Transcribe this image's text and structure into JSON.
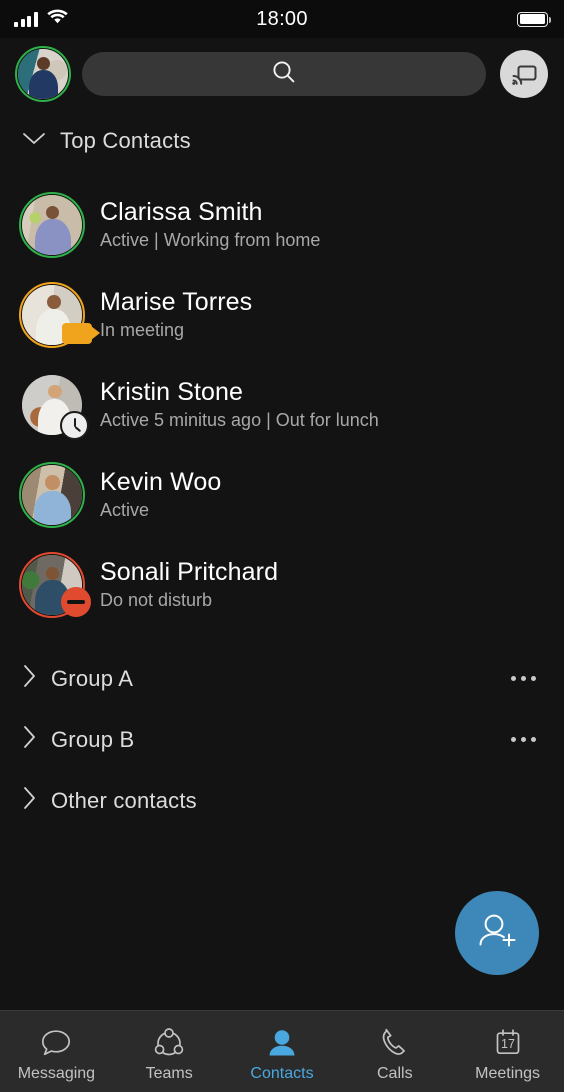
{
  "status_bar": {
    "signal_icon": "cellular-signal-icon",
    "signal_bars": 4,
    "wifi_icon": "wifi-icon",
    "time": "18:00",
    "battery_icon": "battery-full-icon",
    "battery_level_pct": 100
  },
  "header": {
    "profile_avatar": {
      "name": "my-profile-avatar",
      "presence": "available",
      "ring_color": "#2fb14a"
    },
    "search": {
      "icon": "search-icon",
      "value": "",
      "placeholder": ""
    },
    "cast_button": {
      "icon": "cast-screen-icon",
      "label": "Cast"
    }
  },
  "section": {
    "chevron_icon": "chevron-down-icon",
    "title": "Top Contacts",
    "expanded": true
  },
  "contacts": [
    {
      "name": "Clarissa Smith",
      "status": "Active | Working from home",
      "presence": "available",
      "ring_color": "#2fb14a",
      "badge": "none",
      "avatar_name": "avatar-clarissa-smith"
    },
    {
      "name": "Marise Torres",
      "status": "In meeting",
      "presence": "in-a-meeting",
      "ring_color": "#f0a41e",
      "badge": "video-camera-icon",
      "avatar_name": "avatar-marise-torres"
    },
    {
      "name": "Kristin Stone",
      "status": "Active 5 minitus ago | Out for lunch",
      "presence": "away",
      "ring_color": "none",
      "badge": "clock-icon",
      "avatar_name": "avatar-kristin-stone"
    },
    {
      "name": "Kevin Woo",
      "status": "Active",
      "presence": "available",
      "ring_color": "#2fb14a",
      "badge": "none",
      "avatar_name": "avatar-kevin-woo"
    },
    {
      "name": "Sonali Pritchard",
      "status": "Do not disturb",
      "presence": "do-not-disturb",
      "ring_color": "#e04a2f",
      "badge": "do-not-disturb-icon",
      "avatar_name": "avatar-sonali-pritchard"
    }
  ],
  "groups": [
    {
      "label": "Group A",
      "chevron_icon": "chevron-right-icon",
      "has_overflow": true,
      "overflow_icon": "more-options-icon"
    },
    {
      "label": "Group B",
      "chevron_icon": "chevron-right-icon",
      "has_overflow": true,
      "overflow_icon": "more-options-icon"
    },
    {
      "label": "Other contacts",
      "chevron_icon": "chevron-right-icon",
      "has_overflow": false,
      "overflow_icon": ""
    }
  ],
  "fab": {
    "icon": "add-contact-icon",
    "label": "Add contact",
    "color": "#3d88b8"
  },
  "bottom_nav": {
    "active": "Contacts",
    "active_color": "#4aa8e0",
    "items": [
      {
        "label": "Messaging",
        "icon": "chat-bubble-icon"
      },
      {
        "label": "Teams",
        "icon": "teams-network-icon"
      },
      {
        "label": "Contacts",
        "icon": "person-filled-icon"
      },
      {
        "label": "Calls",
        "icon": "phone-handset-icon"
      },
      {
        "label": "Meetings",
        "icon": "calendar-17-icon"
      }
    ]
  }
}
